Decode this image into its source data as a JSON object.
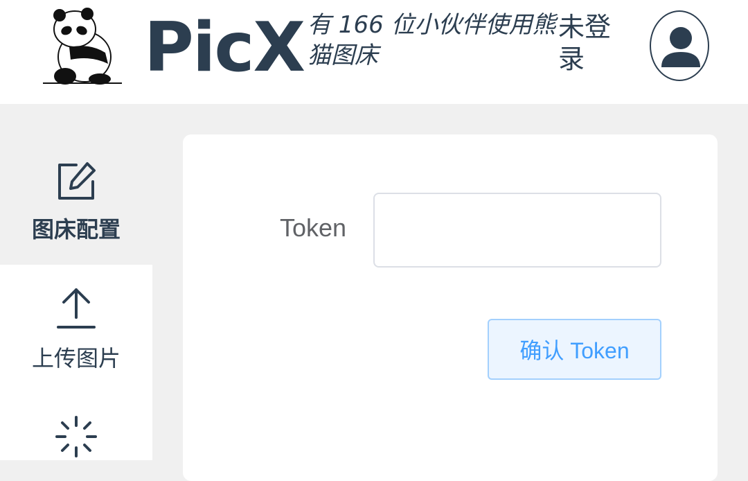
{
  "header": {
    "brand": "PicX",
    "tagline": "有 166 位小伙伴使用熊猫图床",
    "login_status": "未登录"
  },
  "sidebar": {
    "items": [
      {
        "label": "图床配置",
        "icon": "edit-icon",
        "active": true
      },
      {
        "label": "上传图片",
        "icon": "upload-icon",
        "active": false
      },
      {
        "label": "",
        "icon": "loading-icon",
        "active": false
      }
    ]
  },
  "form": {
    "token_label": "Token",
    "token_value": "",
    "confirm_label": "确认 Token"
  },
  "colors": {
    "primary_text": "#2c3e50",
    "accent": "#409eff",
    "button_bg": "#ecf5ff",
    "page_bg": "#f0f0f0"
  }
}
